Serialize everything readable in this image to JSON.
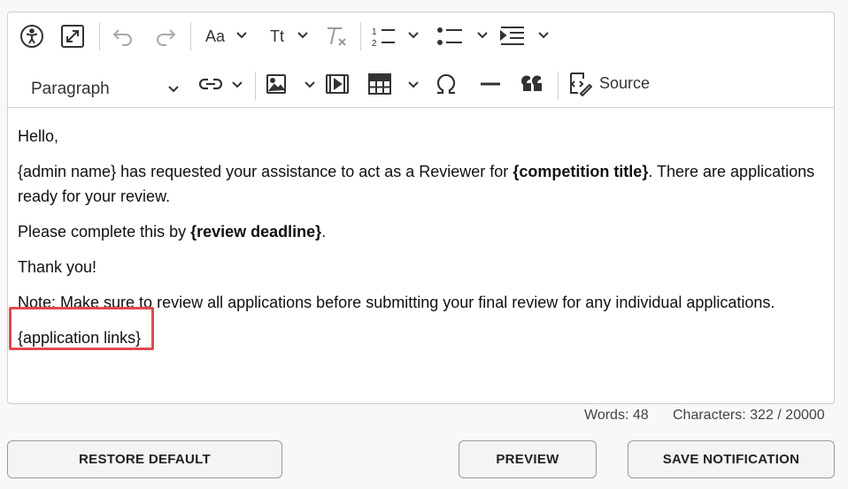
{
  "toolbar": {
    "heading_select": "Paragraph",
    "source_label": "Source",
    "font_size_label": "Aa",
    "font_family_label": "Tt"
  },
  "content": {
    "p1": "Hello,",
    "p2_a": "{admin name} has requested your assistance to act as a Reviewer for ",
    "p2_b": "{competition title}",
    "p2_c": ". There are applications ready for your review.",
    "p3_a": "Please complete this by ",
    "p3_b": "{review deadline}",
    "p3_c": ".",
    "p4": "Thank you!",
    "p5": "Note: Make sure to review all applications before submitting your final review for any individual applications.",
    "p6": "{application links}"
  },
  "status": {
    "words": "Words: 48",
    "characters": "Characters: 322 / 20000"
  },
  "buttons": {
    "restore": "RESTORE DEFAULT",
    "preview": "PREVIEW",
    "save": "SAVE NOTIFICATION"
  },
  "colors": {
    "highlight": "#e04a4f",
    "border": "#cfcfcf"
  }
}
